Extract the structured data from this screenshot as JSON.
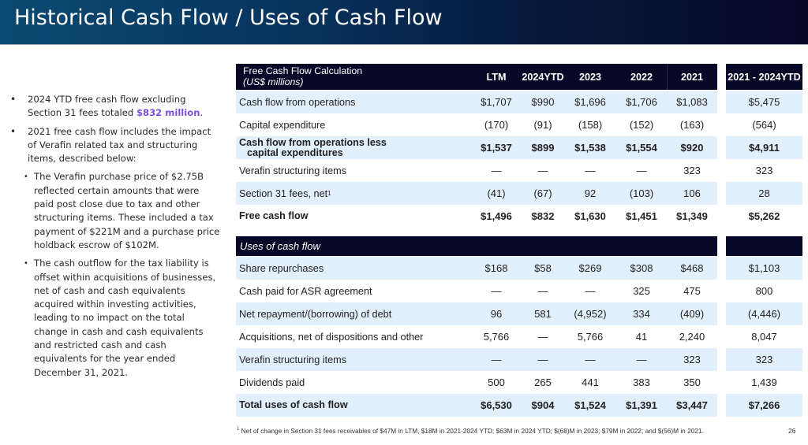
{
  "header": {
    "title": "Historical Cash Flow / Uses of Cash Flow"
  },
  "bullets": [
    {
      "level": 1,
      "text_before": "2024 YTD free cash flow excluding Section 31 fees totaled ",
      "highlight": "$832 million",
      "text_after": "."
    },
    {
      "level": 1,
      "text": "2021 free cash flow includes the impact of Verafin related tax and structuring items, described below:"
    },
    {
      "level": 2,
      "text": "The Verafin purchase price of $2.75B reflected certain amounts that were paid post close due to tax and other structuring items. These included a tax payment of $221M and a purchase price holdback escrow of $102M."
    },
    {
      "level": 2,
      "text": "The cash outflow for the tax liability is offset within acquisitions of businesses, net of cash and cash equivalents acquired within investing activities, leading to no impact on the total change in cash and cash equivalents and restricted cash and cash equivalents for the year ended December 31, 2021."
    }
  ],
  "table": {
    "title": "Free Cash Flow Calculation",
    "subtitle": "(US$ millions)",
    "columns": [
      "LTM",
      "2024 YTD",
      "2023",
      "2022",
      "2021",
      "2021 - 2024 YTD"
    ],
    "column_lines": [
      [
        "LTM"
      ],
      [
        "2024",
        "YTD"
      ],
      [
        "2023"
      ],
      [
        "2022"
      ],
      [
        "2021"
      ],
      [
        "2021 - 2024",
        "YTD"
      ]
    ],
    "fcf_rows": [
      {
        "label": "Cash flow from operations",
        "values": [
          "$1,707",
          "$990",
          "$1,696",
          "$1,706",
          "$1,083",
          "$5,475"
        ],
        "bold": false,
        "shaded": true
      },
      {
        "label": "Capital expenditure",
        "values": [
          "(170)",
          "(91)",
          "(158)",
          "(152)",
          "(163)",
          "(564)"
        ],
        "bold": false,
        "shaded": false
      },
      {
        "label": "Cash flow from operations less capital expenditures",
        "values": [
          "$1,537",
          "$899",
          "$1,538",
          "$1,554",
          "$920",
          "$4,911"
        ],
        "bold": true,
        "shaded": true
      },
      {
        "label": "Verafin structuring items",
        "values": [
          "—",
          "—",
          "—",
          "—",
          "323",
          "323"
        ],
        "bold": false,
        "shaded": false
      },
      {
        "label": "Section 31 fees, net",
        "footnote": "1",
        "values": [
          "(41)",
          "(67)",
          "92",
          "(103)",
          "106",
          "28"
        ],
        "bold": false,
        "shaded": true
      },
      {
        "label": "Free cash flow",
        "values": [
          "$1,496",
          "$832",
          "$1,630",
          "$1,451",
          "$1,349",
          "$5,262"
        ],
        "bold": true,
        "shaded": false
      }
    ],
    "uses_title": "Uses of cash flow",
    "uses_rows": [
      {
        "label": "Share repurchases",
        "values": [
          "$168",
          "$58",
          "$269",
          "$308",
          "$468",
          "$1,103"
        ],
        "bold": false,
        "shaded": true
      },
      {
        "label": "Cash paid for ASR agreement",
        "values": [
          "—",
          "—",
          "—",
          "325",
          "475",
          "800"
        ],
        "bold": false,
        "shaded": false
      },
      {
        "label": "Net repayment/(borrowing) of debt",
        "values": [
          "96",
          "581",
          "(4,952)",
          "334",
          "(409)",
          "(4,446)"
        ],
        "bold": false,
        "shaded": true
      },
      {
        "label": "Acquisitions, net of dispositions and other",
        "values": [
          "5,766",
          "—",
          "5,766",
          "41",
          "2,240",
          "8,047"
        ],
        "bold": false,
        "shaded": false
      },
      {
        "label": "Verafin structuring items",
        "values": [
          "—",
          "—",
          "—",
          "—",
          "323",
          "323"
        ],
        "bold": false,
        "shaded": true
      },
      {
        "label": "Dividends paid",
        "values": [
          "500",
          "265",
          "441",
          "383",
          "350",
          "1,439"
        ],
        "bold": false,
        "shaded": false
      },
      {
        "label": "Total uses of cash flow",
        "values": [
          "$6,530",
          "$904",
          "$1,524",
          "$1,391",
          "$3,447",
          "$7,266"
        ],
        "bold": true,
        "shaded": true
      }
    ]
  },
  "footnote": {
    "marker": "1",
    "text": "Net of change in Section 31 fees receivables of $47M in LTM,  $18M in 2021-2024 YTD; $63M in 2024 YTD;  $(68)M in 2023; $79M in 2022; and $(56)M in 2021."
  },
  "page_number": "26",
  "colors": {
    "header_dark": "#070828",
    "row_shade": "#e2effc",
    "highlight": "#7b4fe0"
  }
}
